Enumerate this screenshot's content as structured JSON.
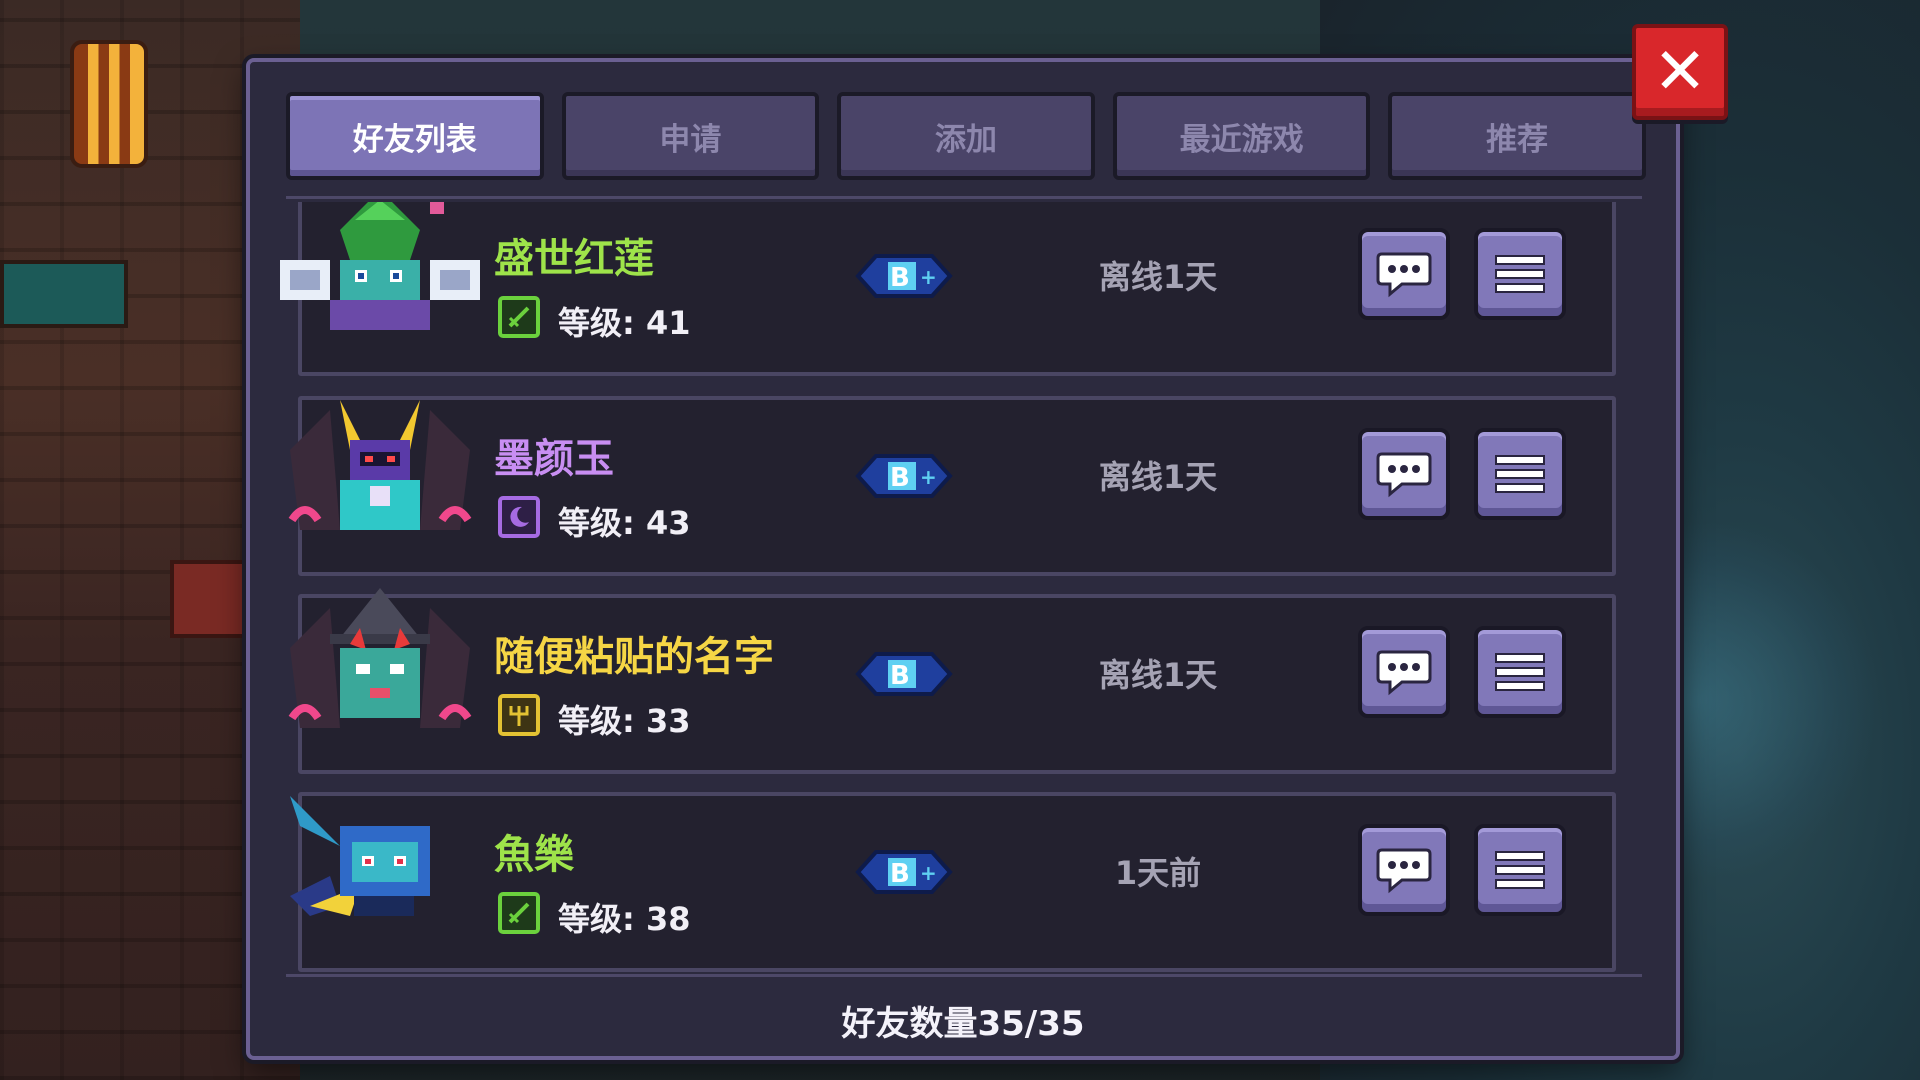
{
  "tabs": [
    {
      "label": "好友列表",
      "active": true
    },
    {
      "label": "申请",
      "active": false
    },
    {
      "label": "添加",
      "active": false
    },
    {
      "label": "最近游戏",
      "active": false
    },
    {
      "label": "推荐",
      "active": false
    }
  ],
  "close_icon": "close-x-icon",
  "friends": [
    {
      "name": "盛世红莲",
      "name_color": "#9ee34a",
      "class_icon": "sword-class-icon",
      "class_color": "#6bd13d",
      "level": "等级: 41",
      "status": "离线1天"
    },
    {
      "name": "墨颜玉",
      "name_color": "#c88ef2",
      "class_icon": "moon-class-icon",
      "class_color": "#a66be3",
      "level": "等级: 43",
      "status": "离线1天"
    },
    {
      "name": "随便粘贴的名字",
      "name_color": "#f6d645",
      "class_icon": "trident-class-icon",
      "class_color": "#e3c233",
      "level": "等级: 33",
      "status": "离线1天"
    },
    {
      "name": "魚樂",
      "name_color": "#9ee34a",
      "class_icon": "sword-class-icon",
      "class_color": "#6bd13d",
      "level": "等级: 38",
      "status": "1天前"
    }
  ],
  "friend_count": "好友数量35/35",
  "colors": {
    "panel": "#2c2a3e",
    "tab_active": "#7d74b6",
    "tab_inactive": "#4a4468",
    "button": "#8178b9",
    "close": "#d9272b"
  }
}
